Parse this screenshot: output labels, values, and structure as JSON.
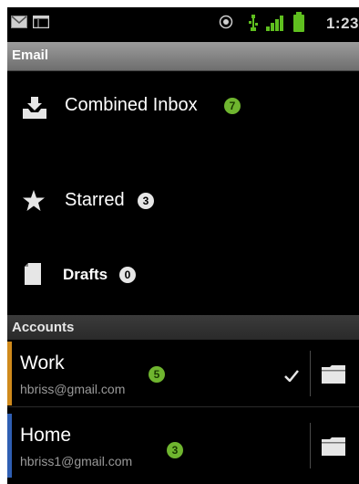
{
  "status_bar": {
    "time": "1:23",
    "icons": [
      "gmail-icon",
      "calendar-icon",
      "location-icon",
      "usb-icon",
      "signal-icon",
      "battery-icon"
    ]
  },
  "title_bar": {
    "title": "Email"
  },
  "folders": [
    {
      "label": "Combined Inbox",
      "count": "7",
      "icon": "inbox-icon",
      "badge_color": "green"
    },
    {
      "label": "Starred",
      "count": "3",
      "icon": "star-icon",
      "badge_color": "white"
    },
    {
      "label": "Drafts",
      "count": "0",
      "icon": "drafts-icon",
      "badge_color": "white"
    }
  ],
  "accounts_header": "Accounts",
  "accounts": [
    {
      "name": "Work",
      "email": "hbriss@gmail.com",
      "count": "5",
      "selected": true,
      "stripe_color": "#d08a1c"
    },
    {
      "name": "Home",
      "email": "hbriss1@gmail.com",
      "count": "3",
      "selected": false,
      "stripe_color": "#2f5fb3"
    }
  ],
  "colors": {
    "badge_green": "#6fb52f",
    "title_bar": "#8a8a8a",
    "background": "#000000"
  }
}
